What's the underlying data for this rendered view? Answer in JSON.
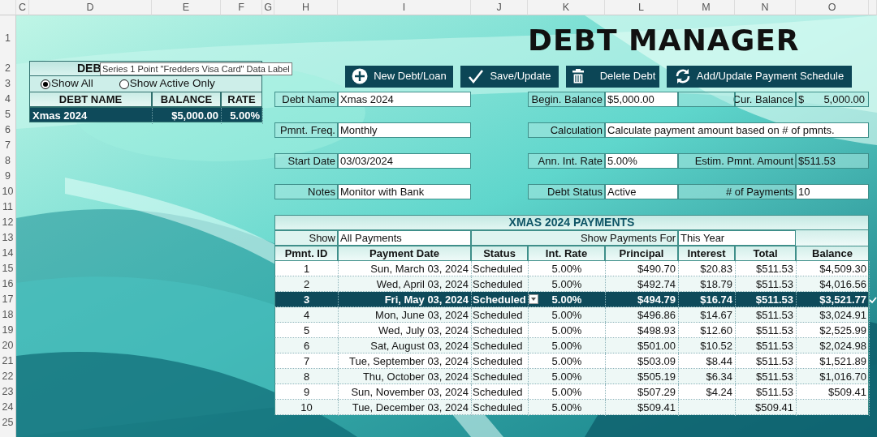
{
  "column_headers": [
    "C",
    "D",
    "E",
    "F",
    "G",
    "H",
    "I",
    "J",
    "K",
    "L",
    "M",
    "N",
    "O"
  ],
  "row_headers": [
    "1",
    "2",
    "3",
    "4",
    "5",
    "6",
    "7",
    "8",
    "9",
    "10",
    "11",
    "12",
    "13",
    "14",
    "15",
    "16",
    "17",
    "18",
    "19",
    "20",
    "21",
    "22",
    "23",
    "24",
    "25"
  ],
  "title": "DEBT MANAGER",
  "buttons": [
    {
      "label": "New Debt/Loan",
      "kind": "add"
    },
    {
      "label": "Save/Update",
      "kind": "save"
    },
    {
      "label": "Delete Debt",
      "kind": "delete"
    },
    {
      "label": "Add/Update Payment Schedule",
      "kind": "refresh"
    }
  ],
  "debt_list": {
    "title": "DEB",
    "options": [
      {
        "label": "Show All",
        "selected": true
      },
      {
        "label": "Show Active Only",
        "selected": false
      }
    ],
    "columns": [
      "DEBT NAME",
      "BALANCE",
      "RATE"
    ],
    "rows": [
      {
        "cells": [
          "Xmas 2024",
          "$5,000.00",
          "5.00%"
        ],
        "selected": true
      }
    ]
  },
  "tooltip": "Series 1 Point \"Fredders Visa Card\" Data Label",
  "form": {
    "rows": [
      {
        "fields": [
          {
            "label": "Debt Name",
            "value": "Xmas 2024",
            "kind": "input"
          },
          {
            "label": "Begin. Balance",
            "value": "$5,000.00",
            "kind": "input"
          },
          {
            "label": "Cur. Balance",
            "currency": "$",
            "value": "5,000.00",
            "kind": "computed"
          }
        ]
      },
      {
        "fields": [
          {
            "label": "Pmnt. Freq.",
            "value": "Monthly",
            "kind": "input"
          },
          {
            "label": "Calculation",
            "value": "Calculate payment amount based on # of pmnts.",
            "kind": "input"
          }
        ]
      },
      {
        "fields": [
          {
            "label": "Start Date",
            "value": "03/03/2024",
            "kind": "input"
          },
          {
            "label": "Ann. Int. Rate",
            "value": "5.00%",
            "kind": "input"
          },
          {
            "label": "Estim. Pmnt. Amount",
            "value": "$511.53",
            "kind": "computed"
          }
        ]
      },
      {
        "fields": [
          {
            "label": "Notes",
            "value": "Monitor with Bank",
            "kind": "input"
          },
          {
            "label": "Debt Status",
            "value": "Active",
            "kind": "input"
          },
          {
            "label": "# of Payments",
            "value": "10",
            "kind": "input"
          }
        ]
      }
    ]
  },
  "payments": {
    "title": "XMAS 2024 PAYMENTS",
    "filters": [
      {
        "label": "Show",
        "value": "All Payments"
      },
      {
        "label": "Show Payments For",
        "value": "This Year"
      }
    ],
    "columns": [
      "Pmnt. ID",
      "Payment Date",
      "Status",
      "Int. Rate",
      "Principal",
      "Interest",
      "Total",
      "Balance"
    ],
    "rows": [
      {
        "cells": [
          "1",
          "Sun, March 03, 2024",
          "Scheduled",
          "5.00%",
          "$490.70",
          "$20.83",
          "$511.53",
          "$4,509.30"
        ],
        "selected": false
      },
      {
        "cells": [
          "2",
          "Wed, April 03, 2024",
          "Scheduled",
          "5.00%",
          "$492.74",
          "$18.79",
          "$511.53",
          "$4,016.56"
        ],
        "selected": false
      },
      {
        "cells": [
          "3",
          "Fri, May 03, 2024",
          "Scheduled",
          "5.00%",
          "$494.79",
          "$16.74",
          "$511.53",
          "$3,521.77"
        ],
        "selected": true
      },
      {
        "cells": [
          "4",
          "Mon, June 03, 2024",
          "Scheduled",
          "5.00%",
          "$496.86",
          "$14.67",
          "$511.53",
          "$3,024.91"
        ],
        "selected": false
      },
      {
        "cells": [
          "5",
          "Wed, July 03, 2024",
          "Scheduled",
          "5.00%",
          "$498.93",
          "$12.60",
          "$511.53",
          "$2,525.99"
        ],
        "selected": false
      },
      {
        "cells": [
          "6",
          "Sat, August 03, 2024",
          "Scheduled",
          "5.00%",
          "$501.00",
          "$10.52",
          "$511.53",
          "$2,024.98"
        ],
        "selected": false
      },
      {
        "cells": [
          "7",
          "Tue, September 03, 2024",
          "Scheduled",
          "5.00%",
          "$503.09",
          "$8.44",
          "$511.53",
          "$1,521.89"
        ],
        "selected": false
      },
      {
        "cells": [
          "8",
          "Thu, October 03, 2024",
          "Scheduled",
          "5.00%",
          "$505.19",
          "$6.34",
          "$511.53",
          "$1,016.70"
        ],
        "selected": false
      },
      {
        "cells": [
          "9",
          "Sun, November 03, 2024",
          "Scheduled",
          "5.00%",
          "$507.29",
          "$4.24",
          "$511.53",
          "$509.41"
        ],
        "selected": false
      },
      {
        "cells": [
          "10",
          "Tue, December 03, 2024",
          "Scheduled",
          "5.00%",
          "$509.41",
          null,
          "$509.41",
          null
        ],
        "selected": false
      }
    ]
  }
}
